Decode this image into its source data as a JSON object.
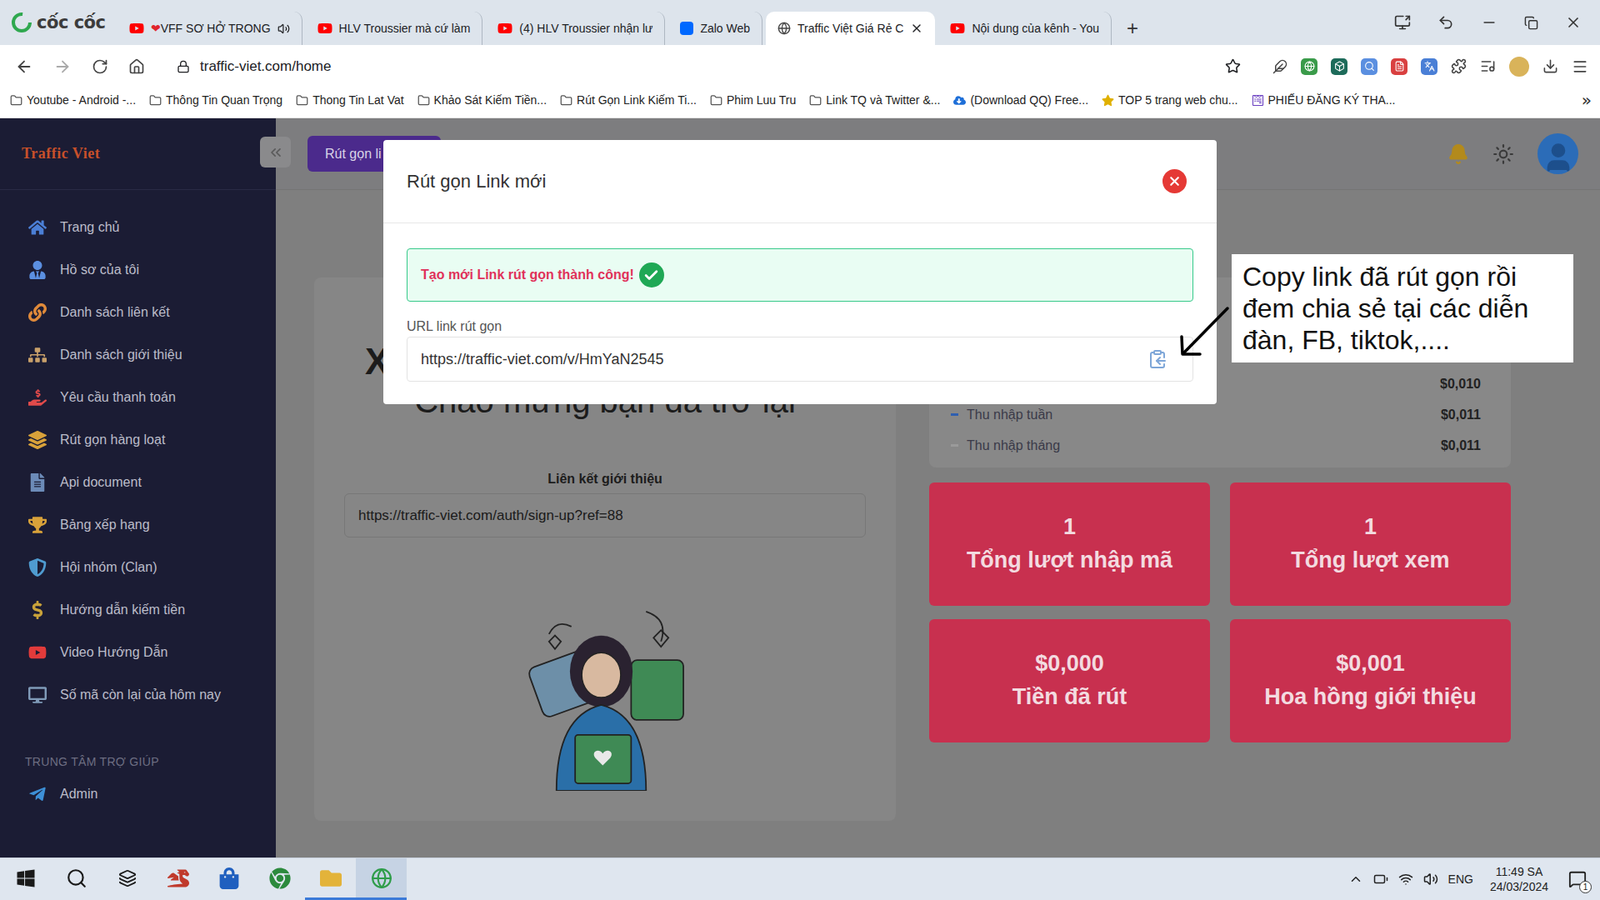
{
  "browser": {
    "logo": "cốc cốc",
    "tabs": [
      {
        "prefix": "❤",
        "label": "VFF SƠ HỞ TRONG",
        "kind": "youtube",
        "audio": true,
        "selected": false
      },
      {
        "prefix": "",
        "label": "HLV Troussier mà cứ làm",
        "kind": "youtube",
        "audio": false,
        "selected": false
      },
      {
        "prefix": "",
        "label": "(4) HLV Troussier nhận lư",
        "kind": "youtube",
        "audio": false,
        "selected": false
      },
      {
        "prefix": "",
        "label": "Zalo Web",
        "kind": "zalo",
        "audio": false,
        "selected": false
      },
      {
        "prefix": "",
        "label": "Traffic Việt Giá Rẻ C",
        "kind": "web",
        "audio": false,
        "selected": true
      },
      {
        "prefix": "",
        "label": "Nội dung của kênh - You",
        "kind": "youtube",
        "audio": false,
        "selected": false
      }
    ],
    "new_tab": "+",
    "address": "traffic-viet.com/home",
    "bookmarks": [
      {
        "label": "Youtube - Android -...",
        "kind": "folder"
      },
      {
        "label": "Thông Tin Quan Trọng",
        "kind": "folder"
      },
      {
        "label": "Thong Tin Lat Vat",
        "kind": "folder"
      },
      {
        "label": "Khảo Sát Kiếm Tiền...",
        "kind": "folder"
      },
      {
        "label": "Rút Gọn Link Kiếm Ti...",
        "kind": "folder"
      },
      {
        "label": "Phim Luu Tru",
        "kind": "folder"
      },
      {
        "label": "Link TQ và Twitter &...",
        "kind": "folder"
      },
      {
        "label": "(Download QQ) Free...",
        "kind": "page"
      },
      {
        "label": "TOP 5 trang web chu...",
        "kind": "page"
      },
      {
        "label": "PHIẾU ĐĂNG KÝ THA...",
        "kind": "page"
      }
    ],
    "bookmarks_more": "»"
  },
  "app": {
    "logo": "Traffic Viet",
    "sidebar": {
      "items": [
        {
          "label": "Trang chủ",
          "selected": false
        },
        {
          "label": "Hồ sơ của tôi",
          "selected": false
        },
        {
          "label": "Danh sách liên kết",
          "selected": false
        },
        {
          "label": "Danh sách giới thiệu",
          "selected": false
        },
        {
          "label": "Yêu cầu thanh toán",
          "selected": false
        },
        {
          "label": "Rút gọn hàng loạt",
          "selected": false
        },
        {
          "label": "Api document",
          "selected": false
        },
        {
          "label": "Bảng xếp hạng",
          "selected": false
        },
        {
          "label": "Hội nhóm (Clan)",
          "selected": false
        },
        {
          "label": "Hướng dẫn kiếm tiền",
          "selected": false
        },
        {
          "label": "Video Hướng Dẫn",
          "selected": false
        },
        {
          "label": "Số mã còn lại của hôm nay",
          "selected": false
        }
      ],
      "section": "TRUNG TÂM TRỢ GIÚP",
      "help_items": [
        {
          "label": "Admin",
          "selected": false
        }
      ]
    },
    "header": {
      "button": "Rút gọn li"
    },
    "welcome": {
      "heading": "X",
      "subheading": "Chào mừng bạn đã trở lại",
      "referral_label": "Liên kết giới thiệu",
      "referral_url": "https://traffic-viet.com/auth/sign-up?ref=88"
    },
    "earnings": {
      "rows": [
        {
          "label": "",
          "value": "$0,010",
          "color": ""
        },
        {
          "label": "Thu nhập tuần",
          "value": "$0,011",
          "color": "#2f5fb0"
        },
        {
          "label": "Thu nhập tháng",
          "value": "$0,011",
          "color": "#9a9a9a"
        }
      ]
    },
    "stats": [
      {
        "value": "1",
        "label": "Tổng lượt nhập mã"
      },
      {
        "value": "1",
        "label": "Tổng lượt xem"
      },
      {
        "value": "$0,000",
        "label": "Tiền đã rút"
      },
      {
        "value": "$0,001",
        "label": "Hoa hồng giới thiệu"
      }
    ]
  },
  "modal": {
    "title": "Rút gọn Link mới",
    "alert": "Tạo mới Link rút gọn thành công!",
    "field_label": "URL link rút gọn",
    "field_value": "https://traffic-viet.com/v/HmYaN2545"
  },
  "annotation": {
    "lines": [
      "Copy link đã rút gọn rồi",
      "đem chia sẻ tại các diễn",
      "đàn, FB, tiktok,...."
    ]
  },
  "taskbar": {
    "apps": [
      {
        "selected": false,
        "open": false
      },
      {
        "selected": false,
        "open": false
      },
      {
        "selected": false,
        "open": false
      },
      {
        "selected": false,
        "open": true
      },
      {
        "selected": true,
        "open": true
      }
    ],
    "language": "ENG",
    "time": "11:49 SA",
    "date": "24/03/2024",
    "notifications": "1"
  }
}
